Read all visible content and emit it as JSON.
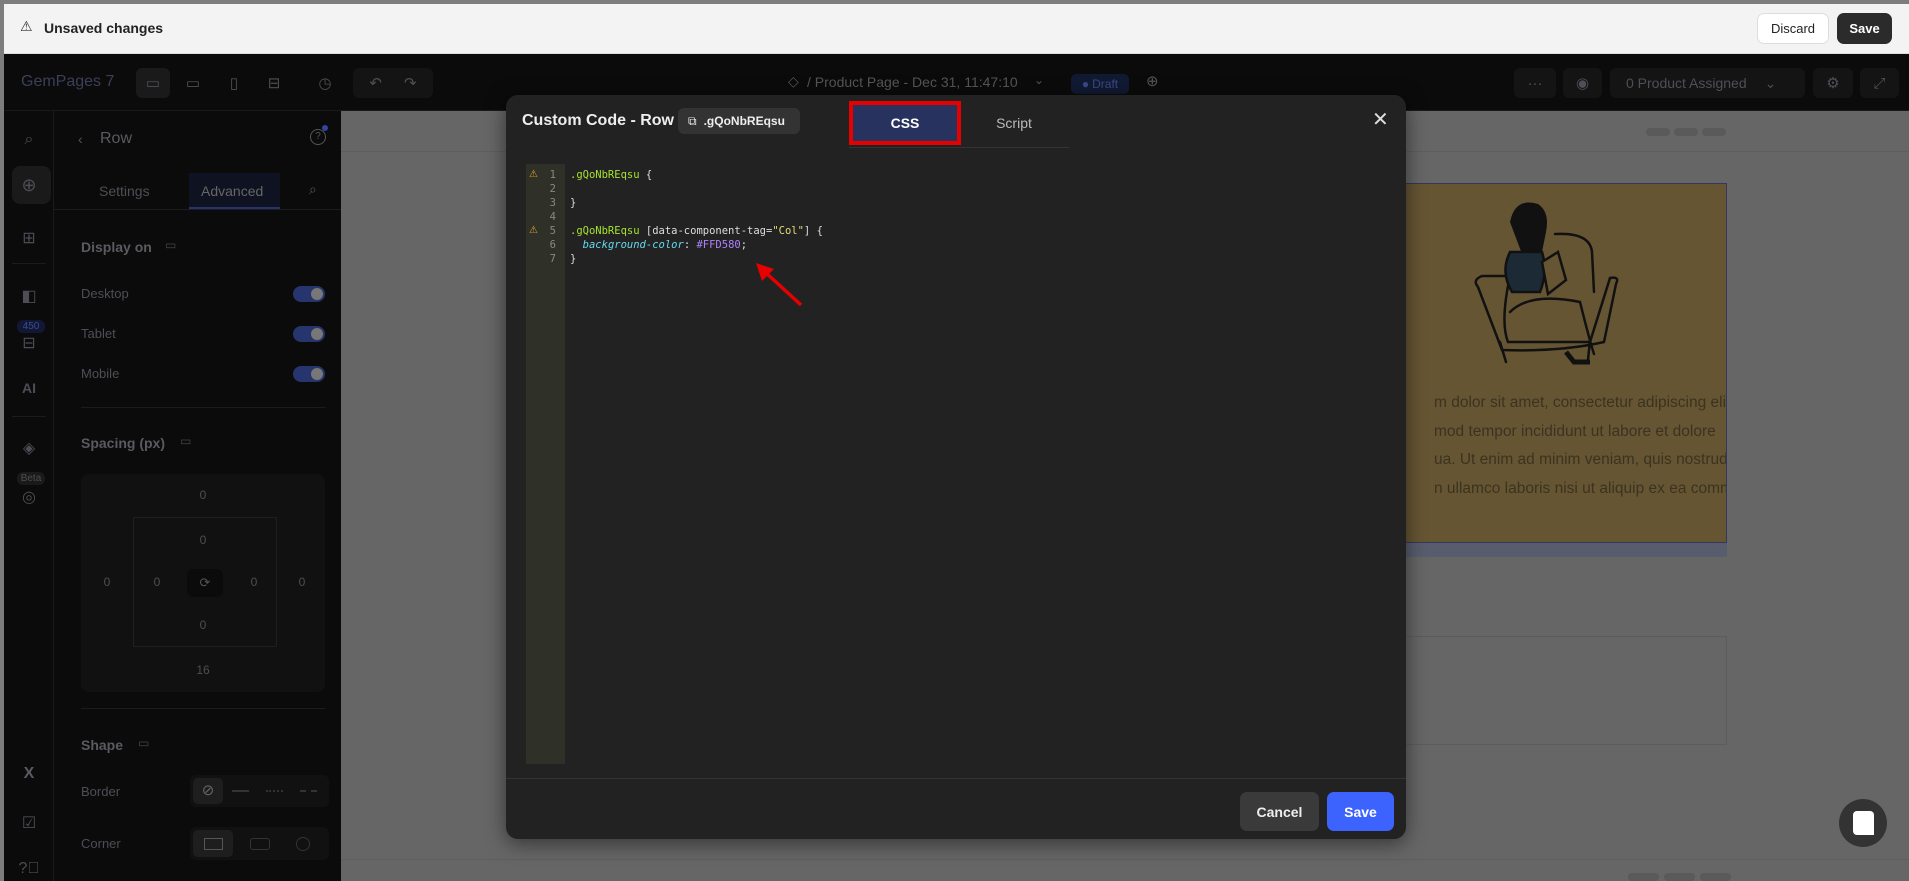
{
  "topbar": {
    "message": "Unsaved changes",
    "discard": "Discard",
    "save": "Save"
  },
  "toolbar": {
    "brand": "GemPages 7",
    "page_title": "/ Product Page - Dec 31, 11:47:10",
    "status": "Draft",
    "product_assigned": "0 Product Assigned",
    "more": "···"
  },
  "rail": {
    "badge": "450",
    "ai": "AI",
    "beta": "Beta"
  },
  "panel": {
    "title": "Row",
    "tabs": [
      "Settings",
      "Advanced"
    ],
    "active_tab": "Advanced",
    "display_on": {
      "label": "Display on",
      "items": [
        {
          "label": "Desktop",
          "on": true
        },
        {
          "label": "Tablet",
          "on": true
        },
        {
          "label": "Mobile",
          "on": true
        }
      ]
    },
    "spacing": {
      "label": "Spacing (px)",
      "margin_top": "0",
      "margin_right": "0",
      "margin_bottom": "16",
      "margin_left": "0",
      "padding_top": "0",
      "padding_right": "0",
      "padding_bottom": "0",
      "padding_left": "0"
    },
    "shape": {
      "label": "Shape",
      "border_label": "Border",
      "corner_label": "Corner"
    }
  },
  "modal": {
    "title": "Custom Code - Row",
    "class_chip": ".gQoNbREqsu",
    "tabs": [
      "CSS",
      "Script"
    ],
    "active_tab": "CSS",
    "code_lines": [
      {
        "n": "1",
        "warn": true,
        "parts": [
          {
            "t": ".gQoNbREqsu",
            "c": "sel"
          },
          {
            "t": " {",
            "c": ""
          }
        ]
      },
      {
        "n": "2",
        "warn": false,
        "parts": []
      },
      {
        "n": "3",
        "warn": false,
        "parts": [
          {
            "t": "}",
            "c": ""
          }
        ]
      },
      {
        "n": "4",
        "warn": false,
        "parts": []
      },
      {
        "n": "5",
        "warn": true,
        "parts": [
          {
            "t": ".gQoNbREqsu",
            "c": "sel"
          },
          {
            "t": " [data-component-tag=",
            "c": ""
          },
          {
            "t": "\"Col\"",
            "c": "str"
          },
          {
            "t": "] {",
            "c": ""
          }
        ]
      },
      {
        "n": "6",
        "warn": false,
        "parts": [
          {
            "t": "  ",
            "c": ""
          },
          {
            "t": "background-color",
            "c": "prop"
          },
          {
            "t": ": ",
            "c": ""
          },
          {
            "t": "#FFD580",
            "c": "val"
          },
          {
            "t": ";",
            "c": ""
          }
        ]
      },
      {
        "n": "7",
        "warn": false,
        "parts": [
          {
            "t": "}",
            "c": ""
          }
        ]
      }
    ],
    "cancel": "Cancel",
    "save": "Save"
  },
  "canvas": {
    "lorem_lines": [
      "m dolor sit amet, consectetur adipiscing elit,",
      "mod tempor incididunt ut labore et dolore",
      "ua. Ut enim ad minim veniam, quis nostrud",
      "n ullamco laboris nisi ut aliquip ex ea commodo"
    ]
  },
  "colors": {
    "accent": "#3d63ff",
    "highlight": "#e60000",
    "column_bg": "#FFD580",
    "tab_active": "#27335e"
  }
}
